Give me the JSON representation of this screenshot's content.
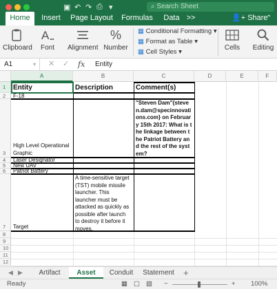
{
  "titlebar": {
    "search_placeholder": "Search Sheet",
    "share_label": "Share",
    "tabs": [
      "Home",
      "Insert",
      "Page Layout",
      "Formulas",
      "Data",
      ">>"
    ]
  },
  "ribbon": {
    "clipboard": "Clipboard",
    "font": "Font",
    "alignment": "Alignment",
    "number": "Number",
    "number_symbol": "%",
    "conditional_formatting": "Conditional Formatting",
    "format_as_table": "Format as Table",
    "cell_styles": "Cell Styles",
    "cells": "Cells",
    "editing": "Editing"
  },
  "formula_bar": {
    "name_box": "A1",
    "fx": "fx",
    "value": "Entity"
  },
  "columns": [
    "A",
    "B",
    "C",
    "D",
    "E",
    "F"
  ],
  "rows": [
    "1",
    "2",
    "3",
    "4",
    "5",
    "6",
    "7",
    "8",
    "9",
    "10",
    "11",
    "12"
  ],
  "cells": {
    "a1": "Entity",
    "b1": "Description",
    "c1": "Comment(s)",
    "a2": "F-18",
    "a3": "High Level Operational Graphic",
    "c3": "\"Steven Dam\"{steven.dam@specinnovations.com} on February 15th 2017: What is the linkage between the Patriot Battery and the rest of the system?",
    "a4": "Laser Designator",
    "a5": "New UAV",
    "a6": "Patriot Battery",
    "a7": "Target",
    "b7": "A time-sensitive target (TST) mobile missile launcher. This launcher must be attacked as quickly as possible after launch to destroy it before it moves."
  },
  "sheet_tabs": [
    "Artifact",
    "Asset",
    "Conduit",
    "Statement"
  ],
  "active_sheet": "Asset",
  "status": {
    "ready": "Ready",
    "zoom": "100%",
    "zoom_minus": "−",
    "zoom_plus": "+"
  },
  "colors": {
    "excel_green": "#1e7145"
  }
}
